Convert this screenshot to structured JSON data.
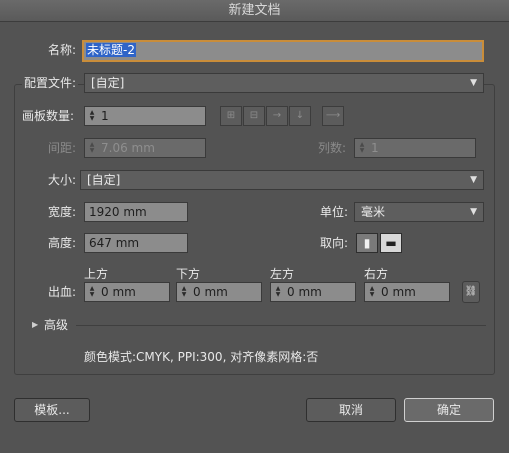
{
  "window": {
    "title": "新建文档"
  },
  "name": {
    "label": "名称:",
    "value": "未标题-2"
  },
  "profile": {
    "label": "配置文件:",
    "value": "[自定]"
  },
  "artboards": {
    "count_label": "画板数量:",
    "count_value": "1",
    "spacing_label": "间距:",
    "spacing_value": "7.06 mm",
    "columns_label": "列数:",
    "columns_value": "1",
    "layout_icons": [
      "grid-by-row-icon",
      "grid-by-column-icon",
      "arrange-by-row-icon",
      "arrange-by-column-icon",
      "right-to-left-icon"
    ]
  },
  "size": {
    "label": "大小:",
    "value": "[自定]"
  },
  "width": {
    "label": "宽度:",
    "value": "1920 mm"
  },
  "height": {
    "label": "高度:",
    "value": "647 mm"
  },
  "units": {
    "label": "单位:",
    "value": "毫米"
  },
  "orientation": {
    "label": "取向:",
    "options": [
      "portrait",
      "landscape"
    ],
    "selected": "landscape"
  },
  "bleed": {
    "label": "出血:",
    "top": {
      "label": "上方",
      "value": "0 mm"
    },
    "bottom": {
      "label": "下方",
      "value": "0 mm"
    },
    "left": {
      "label": "左方",
      "value": "0 mm"
    },
    "right": {
      "label": "右方",
      "value": "0 mm"
    },
    "link_icon": "chain-link-icon"
  },
  "advanced": {
    "label": "高级"
  },
  "summary": "颜色模式:CMYK, PPI:300, 对齐像素网格:否",
  "buttons": {
    "templates": "模板...",
    "cancel": "取消",
    "ok": "确定"
  }
}
